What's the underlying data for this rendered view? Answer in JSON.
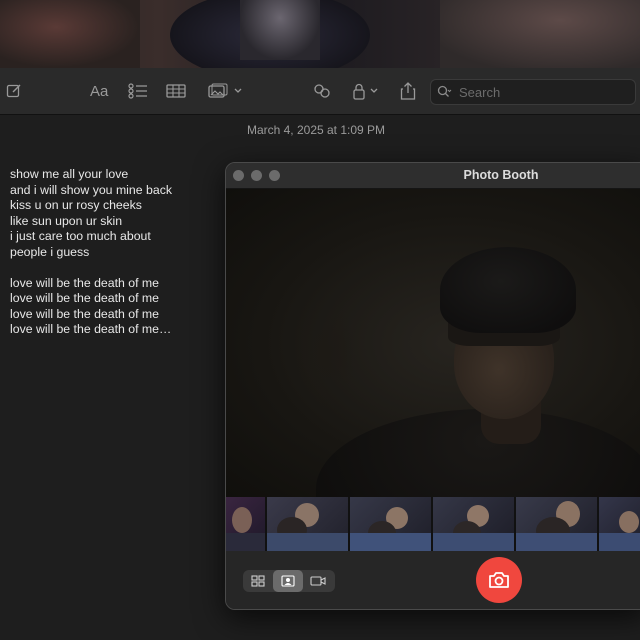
{
  "notes": {
    "toolbar": {
      "search_placeholder": "Search"
    },
    "date": "March 4, 2025 at 1:09 PM",
    "lines": [
      "show me all your love",
      "and i will show you mine back",
      "kiss u on ur rosy cheeks",
      "like sun upon ur skin",
      "i just care too much about",
      "people i guess",
      "",
      "love will be the death of me",
      "love will be the death of me",
      "love will be the death of me",
      "love will be the death of me…"
    ]
  },
  "photo_booth": {
    "title": "Photo Booth",
    "accent_color": "#f0473e",
    "thumbnails": 6,
    "view_modes": [
      "grid-icon",
      "portrait-icon",
      "video-icon"
    ],
    "active_mode": "portrait-icon"
  }
}
